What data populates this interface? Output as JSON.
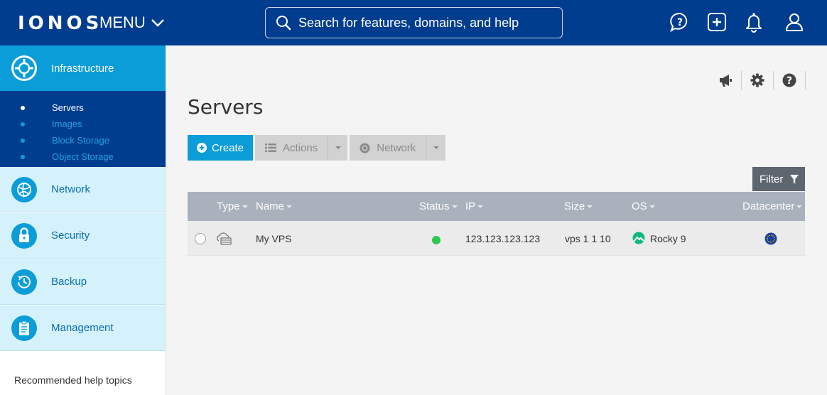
{
  "header": {
    "logo": "IONOS",
    "menu_label": "MENU",
    "search_placeholder": "Search for features, domains, and help",
    "icons": [
      "help-bubble-icon",
      "add-icon",
      "bell-icon",
      "user-icon"
    ]
  },
  "sidebar": {
    "active_section": {
      "label": "Infrastructure",
      "icon": "infrastructure-icon"
    },
    "subitems": [
      {
        "label": "Servers",
        "current": true
      },
      {
        "label": "Images",
        "current": false
      },
      {
        "label": "Block Storage",
        "current": false
      },
      {
        "label": "Object Storage",
        "current": false
      }
    ],
    "sections": [
      {
        "label": "Network",
        "icon": "network-globe-icon"
      },
      {
        "label": "Security",
        "icon": "lock-icon"
      },
      {
        "label": "Backup",
        "icon": "clock-backup-icon"
      },
      {
        "label": "Management",
        "icon": "clipboard-icon"
      }
    ],
    "help_topics": "Recommended help topics"
  },
  "main": {
    "title": "Servers",
    "utility_icons": [
      "megaphone-icon",
      "gear-icon",
      "help-icon"
    ],
    "toolbar": {
      "create_label": "Create",
      "actions_label": "Actions",
      "network_label": "Network"
    },
    "filter_label": "Filter",
    "table": {
      "columns": [
        "Type",
        "Name",
        "Status",
        "IP",
        "Size",
        "OS",
        "Datacenter"
      ],
      "rows": [
        {
          "type_icon": "cloud-server-icon",
          "name": "My VPS",
          "status": "running",
          "status_color": "#2ec84e",
          "ip": "123.123.123.123",
          "size": "vps 1 1 10",
          "os": "Rocky 9",
          "os_icon": "rocky-linux-icon",
          "datacenter_icon": "eu-flag-icon"
        }
      ]
    }
  },
  "colors": {
    "header_bg": "#003d8f",
    "accent": "#0b9dd8",
    "sidebar_light": "#d5f1fb",
    "table_header": "#a9b1bc",
    "status_ok": "#2ec84e"
  }
}
